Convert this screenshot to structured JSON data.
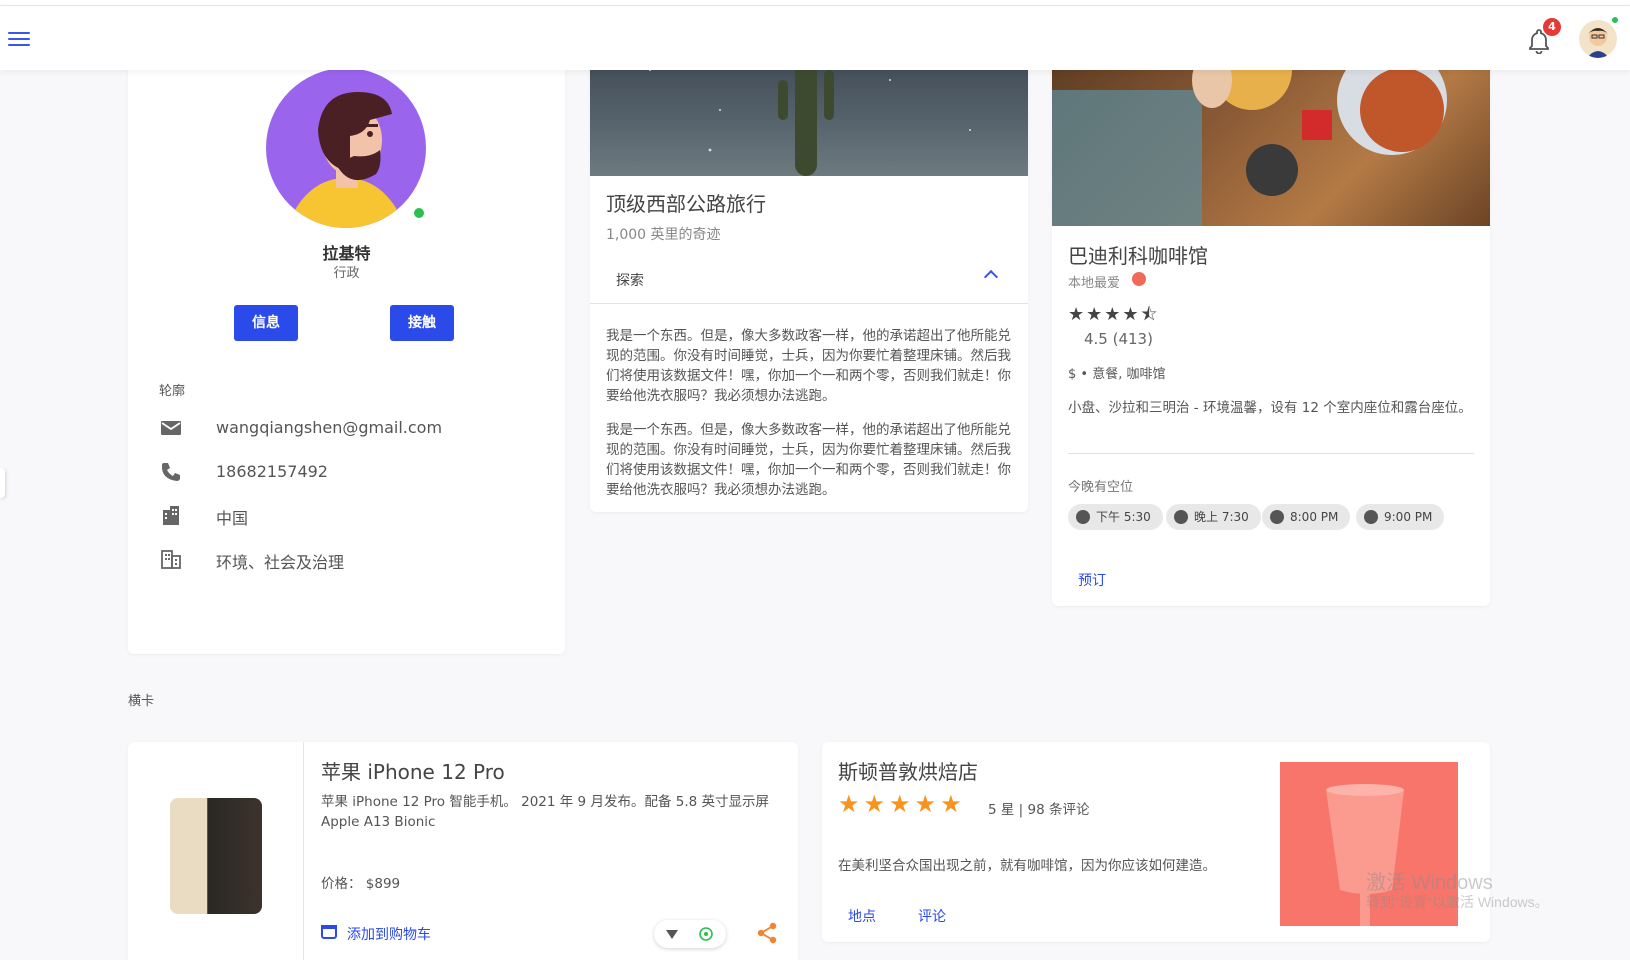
{
  "header": {
    "notification_count": "4",
    "accent": "#3a57e8"
  },
  "profile": {
    "name": "拉基特",
    "role": "行政",
    "buttons": {
      "message": "信息",
      "contact": "接触"
    },
    "section_title": "轮廓",
    "info": {
      "email": "wangqiangshen@gmail.com",
      "phone": "18682157492",
      "country": "中国",
      "department": "环境、社会及治理"
    }
  },
  "travel": {
    "title": "顶级西部公路旅行",
    "subtitle": "1,000 英里的奇迹",
    "explore_label": "探索",
    "paragraphs": [
      "我是一个东西。但是，像大多数政客一样，他的承诺超出了他所能兑现的范围。你没有时间睡觉，士兵，因为你要忙着整理床铺。然后我们将使用该数据文件！嘿，你加一个一和两个零，否则我们就走！你要给他洗衣服吗？我必须想办法逃跑。",
      "我是一个东西。但是，像大多数政客一样，他的承诺超出了他所能兑现的范围。你没有时间睡觉，士兵，因为你要忙着整理床铺。然后我们将使用该数据文件！嘿，你加一个一和两个零，否则我们就走！你要给他洗衣服吗？我必须想办法逃跑。"
    ]
  },
  "cafe": {
    "title": "巴迪利科咖啡馆",
    "location": "本地最爱",
    "stars": "★★★★⯪",
    "rating": 4.5,
    "rating_text": "4.5 (413)",
    "price_category": "$ • 意餐, 咖啡馆",
    "description": "小盘、沙拉和三明治 - 环境温馨，设有 12 个室内座位和露台座位。",
    "availability_label": "今晚有空位",
    "times": [
      "下午 5:30",
      "晚上 7:30",
      "8:00 PM",
      "9:00 PM"
    ],
    "book_label": "预订"
  },
  "section_label": "横卡",
  "phone_card": {
    "title": "苹果 iPhone 12 Pro",
    "description": "苹果 iPhone 12 Pro 智能手机。 2021 年 9 月发布。配备 5.8 英寸显示屏 Apple A13 Bionic",
    "price": "价格： $899",
    "add_to_cart": "添加到购物车"
  },
  "bakery": {
    "title": "斯顿普敦烘焙店",
    "stars": "★★★★★",
    "rating": 5,
    "reviews": "5 星 | 98 条评论",
    "description": "在美利坚合众国出现之前，就有咖啡馆，因为你应该如何建造。",
    "links": {
      "location": "地点",
      "review": "评论"
    }
  },
  "watermark": {
    "title": "激活 Windows",
    "subtitle": "转到\"设置\"以激活 Windows。"
  }
}
